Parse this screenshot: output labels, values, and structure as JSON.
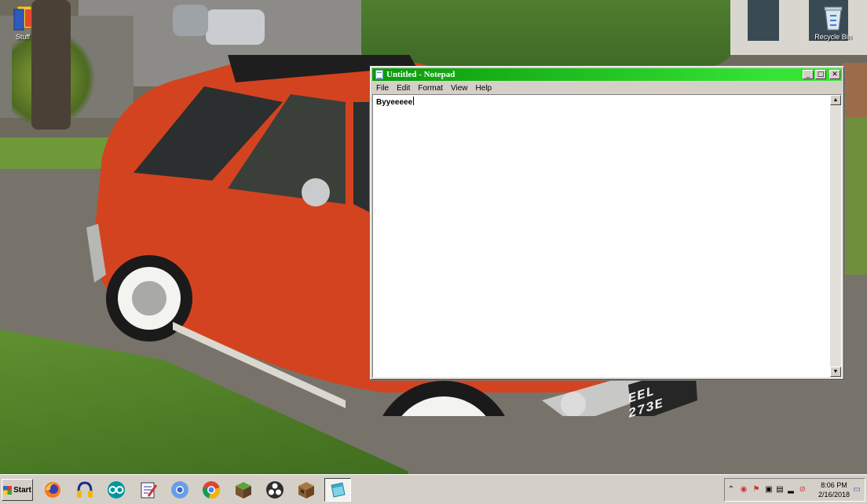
{
  "desktop": {
    "icons": [
      {
        "label": "Stuff",
        "icon": "folder-book-icon"
      },
      {
        "label": "Recycle Bin",
        "icon": "recycle-bin-icon"
      }
    ],
    "car_plate": "EEL 273E"
  },
  "notepad": {
    "title": "Untitled - Notepad",
    "menu": [
      "File",
      "Edit",
      "Format",
      "View",
      "Help"
    ],
    "content": "Byyeeeee",
    "title_gradient": [
      "#0a9a0a",
      "#35e335"
    ]
  },
  "taskbar": {
    "start_label": "Start",
    "apps": [
      {
        "name": "firefox-icon"
      },
      {
        "name": "audacity-icon"
      },
      {
        "name": "arduino-icon"
      },
      {
        "name": "notepad-edit-icon"
      },
      {
        "name": "chromium-icon"
      },
      {
        "name": "chrome-icon"
      },
      {
        "name": "minecraft-icon"
      },
      {
        "name": "obs-icon"
      },
      {
        "name": "crafting-table-icon"
      },
      {
        "name": "notepad-icon",
        "active": true
      }
    ],
    "tray": {
      "time": "8:06 PM",
      "date": "2/16/2018"
    }
  }
}
